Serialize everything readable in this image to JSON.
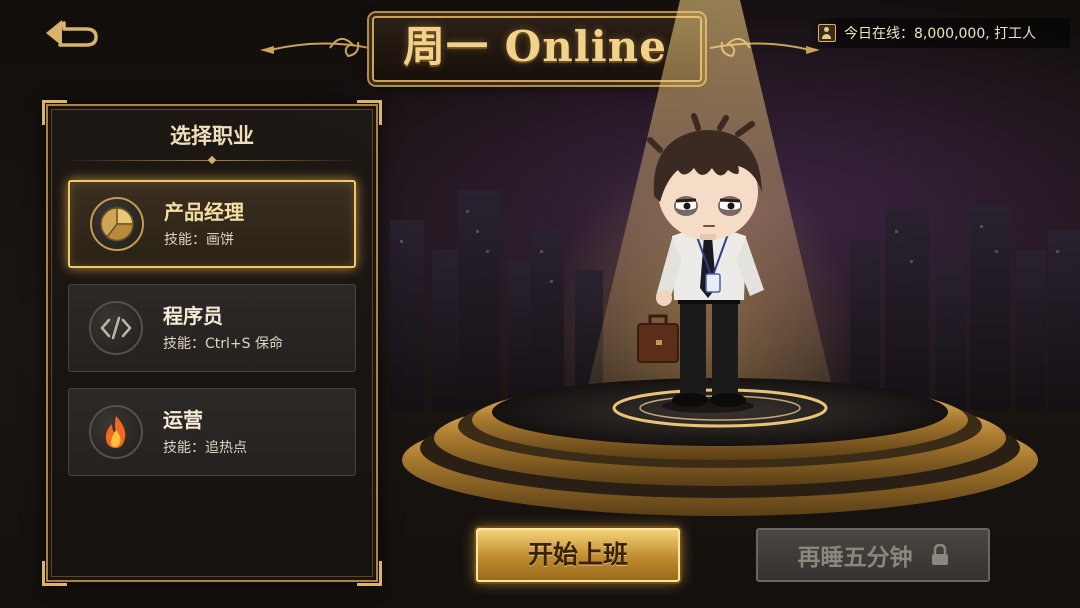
{
  "header": {
    "back_icon": "back-arrow-icon",
    "title": "周一 Online",
    "online_icon": "person-badge-icon",
    "online_text": "今日在线：8,000,000, 打工人"
  },
  "job_panel": {
    "title": "选择职业",
    "jobs": [
      {
        "name": "产品经理",
        "skill": "技能：画饼",
        "icon": "pie-chart-icon",
        "selected": true
      },
      {
        "name": "程序员",
        "skill": "技能：Ctrl+S 保命",
        "icon": "code-icon",
        "selected": false
      },
      {
        "name": "运营",
        "skill": "技能：追热点",
        "icon": "flame-icon",
        "selected": false
      }
    ]
  },
  "buttons": {
    "start_label": "开始上班",
    "snooze_label": "再睡五分钟",
    "snooze_locked": true
  },
  "colors": {
    "accent_gold": "#f1c868",
    "panel_border": "#a8844a",
    "disabled_text": "#8d867d"
  }
}
